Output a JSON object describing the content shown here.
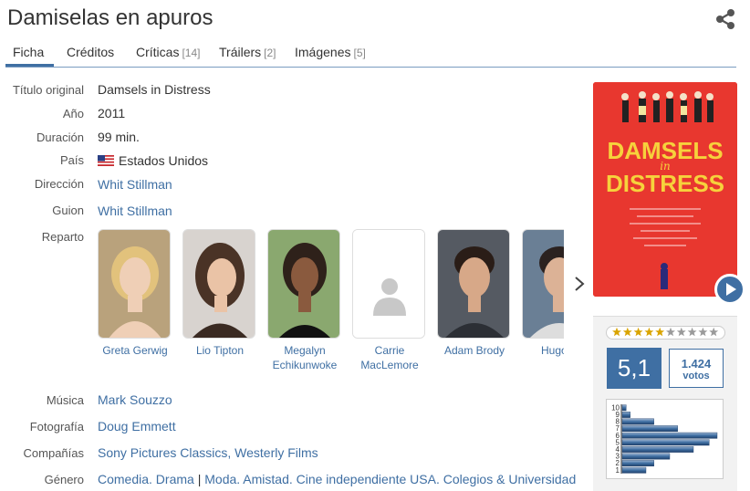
{
  "title": "Damiselas en apuros",
  "tabs": [
    {
      "label": "Ficha",
      "count": ""
    },
    {
      "label": "Créditos",
      "count": ""
    },
    {
      "label": "Críticas",
      "count": "[14]"
    },
    {
      "label": "Tráilers",
      "count": "[2]"
    },
    {
      "label": "Imágenes",
      "count": "[5]"
    }
  ],
  "details": {
    "original_title_label": "Título original",
    "original_title": "Damsels in Distress",
    "year_label": "Año",
    "year": "2011",
    "duration_label": "Duración",
    "duration": "99 min.",
    "country_label": "País",
    "country": "Estados Unidos",
    "director_label": "Dirección",
    "director": "Whit Stillman",
    "script_label": "Guion",
    "script": "Whit Stillman",
    "cast_label": "Reparto",
    "music_label": "Música",
    "music": "Mark Souzzo",
    "photo_label": "Fotografía",
    "photo": "Doug Emmett",
    "company_label": "Compañías",
    "company": "Sony Pictures Classics, Westerly Films",
    "genre_label": "Género",
    "genre_a": "Comedia. Drama",
    "genre_sep": "|",
    "genre_b": "Moda. Amistad. Cine independiente USA. Colegios & Universidad"
  },
  "cast": [
    {
      "line1": "Greta Gerwig",
      "line2": ""
    },
    {
      "line1": "Lio Tipton",
      "line2": ""
    },
    {
      "line1": "Megalyn",
      "line2": "Echikunwoke"
    },
    {
      "line1": "Carrie",
      "line2": "MacLemore"
    },
    {
      "line1": "Adam Brody",
      "line2": ""
    },
    {
      "line1": "Hugo B",
      "line2": ""
    }
  ],
  "poster": {
    "line1": "DAMSELS",
    "line_in": "in",
    "line2": "DISTRESS"
  },
  "rating": {
    "score": "5,1",
    "votes_count": "1.424",
    "votes_label": "votos",
    "stars_filled": 5,
    "stars_total": 10
  },
  "colors": {
    "accent": "#3f6fa3",
    "poster_red": "#e8372f",
    "poster_yellow": "#f6d23c"
  },
  "chart_data": {
    "type": "bar",
    "categories": [
      "1",
      "2",
      "3",
      "4",
      "5",
      "6",
      "7",
      "8",
      "9",
      "10"
    ],
    "values": [
      3,
      4,
      6,
      9,
      11,
      12,
      7,
      4,
      1,
      0.5
    ],
    "title": "",
    "xlabel": "",
    "ylabel": ""
  }
}
